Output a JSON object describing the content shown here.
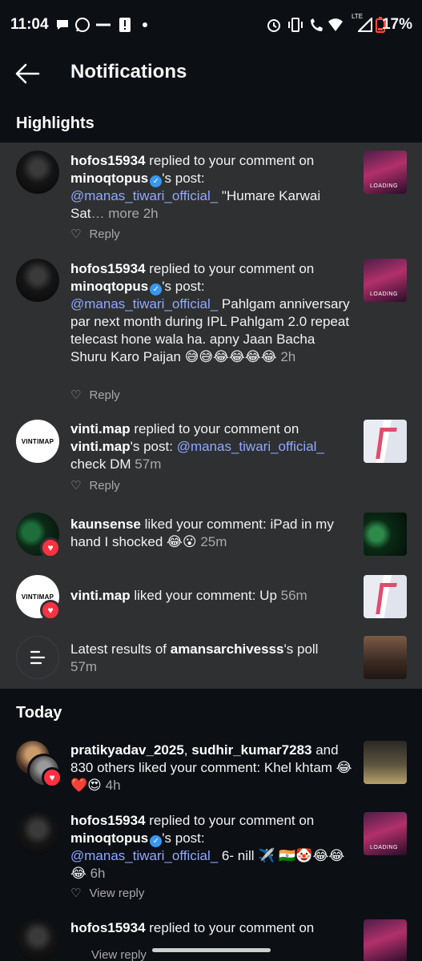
{
  "status_bar": {
    "time": "11:04",
    "battery": "17%",
    "lte": "LTE"
  },
  "header": {
    "title": "Notifications"
  },
  "sections": {
    "highlights": "Highlights",
    "today": "Today"
  },
  "highlights": [
    {
      "user": "hofos15934",
      "action": " replied to your comment on ",
      "target": "minoqtopus",
      "target_suffix": "'s post:",
      "mention": "@manas_tiwari_official_",
      "comment": " \"Humare Karwai Sat",
      "more": "… more",
      "time": " 2h",
      "reply_label": "Reply",
      "thumb_label": "LOADING"
    },
    {
      "user": "hofos15934",
      "action": " replied to your comment on ",
      "target": "minoqtopus",
      "target_suffix": "'s post:",
      "mention": "@manas_tiwari_official_",
      "comment": " Pahlgam anniversary par next month during IPL Pahlgam 2.0 repeat telecast hone wala ha. apny Jaan Bacha Shuru Karo Paijan 😅😅😂😂😂😂",
      "time": " 2h",
      "reply_label": "Reply",
      "thumb_label": "LOADING"
    },
    {
      "user": "vinti.map",
      "action": " replied to your comment on ",
      "target": "vinti.map",
      "target_suffix": "'s post: ",
      "mention": "@manas_tiwari_official_",
      "comment": " check DM",
      "time": " 57m",
      "reply_label": "Reply",
      "avatar_text": "VINTIMAP"
    },
    {
      "user": "kaunsense",
      "action": " liked your comment: iPad in my hand I shocked 😂😮",
      "time": " 25m"
    },
    {
      "user": "vinti.map",
      "action": " liked your comment: Up",
      "time": " 56m",
      "avatar_text": "VINTIMAP"
    },
    {
      "prefix": "Latest results of ",
      "user": "amansarchivesss",
      "suffix": "'s poll",
      "time": "57m"
    }
  ],
  "today": [
    {
      "user1": "pratikyadav_2025",
      "sep": ", ",
      "user2": "sudhir_kumar7283",
      "action": " and 830 others liked your comment: Khel khtam 😂❤️😍",
      "time": " 4h"
    },
    {
      "user": "hofos15934",
      "action": " replied to your comment on ",
      "target": "minoqtopus",
      "target_suffix": "'s post:",
      "mention": "@manas_tiwari_official_",
      "comment": " 6- nill ✈️ 🇮🇳🤡😂😂😂",
      "time": " 6h",
      "reply_label": "View reply",
      "thumb_label": "LOADING"
    },
    {
      "user": "hofos15934",
      "action": " replied to your comment on",
      "reply_label": "View reply"
    }
  ],
  "colors": {
    "background": "#0c0f14",
    "highlight_bg": "#2f3032",
    "mention": "#8fa8ff",
    "like_red": "#ff3040",
    "verified": "#3897f0"
  }
}
